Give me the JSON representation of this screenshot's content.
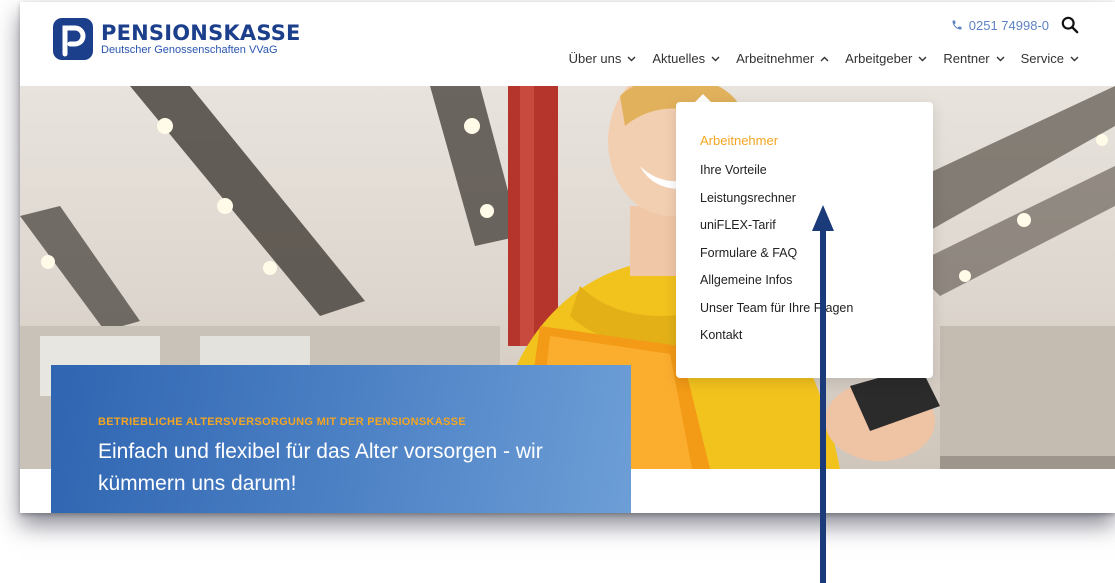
{
  "brand": {
    "name": "PENSIONSKASSE",
    "subtitle": "Deutscher Genossenschaften VVaG",
    "color": "#1c3f8c"
  },
  "topbar": {
    "phone": "0251 74998-0",
    "phone_icon": "phone-icon",
    "search_icon": "search-icon"
  },
  "nav": {
    "items": [
      {
        "label": "Über uns",
        "chevron": "down"
      },
      {
        "label": "Aktuelles",
        "chevron": "down"
      },
      {
        "label": "Arbeitnehmer",
        "chevron": "up"
      },
      {
        "label": "Arbeitgeber",
        "chevron": "down"
      },
      {
        "label": "Rentner",
        "chevron": "down"
      },
      {
        "label": "Service",
        "chevron": "down"
      }
    ]
  },
  "dropdown": {
    "heading": "Arbeitnehmer",
    "items": [
      "Ihre Vorteile",
      "Leistungsrechner",
      "uniFLEX-Tarif",
      "Formulare & FAQ",
      "Allgemeine Infos",
      "Unser Team für Ihre Fragen",
      "Kontakt"
    ]
  },
  "promo": {
    "eyebrow": "BETRIEBLICHE ALTERSVERSORGUNG MIT DER PENSIONSKASSE",
    "headline": "Einfach und flexibel für das Alter vorsorgen - wir kümmern uns darum!"
  },
  "colors": {
    "accent_orange": "#f4a521",
    "promo_blue": "#3d72bb",
    "arrow_navy": "#1b3a7a"
  }
}
